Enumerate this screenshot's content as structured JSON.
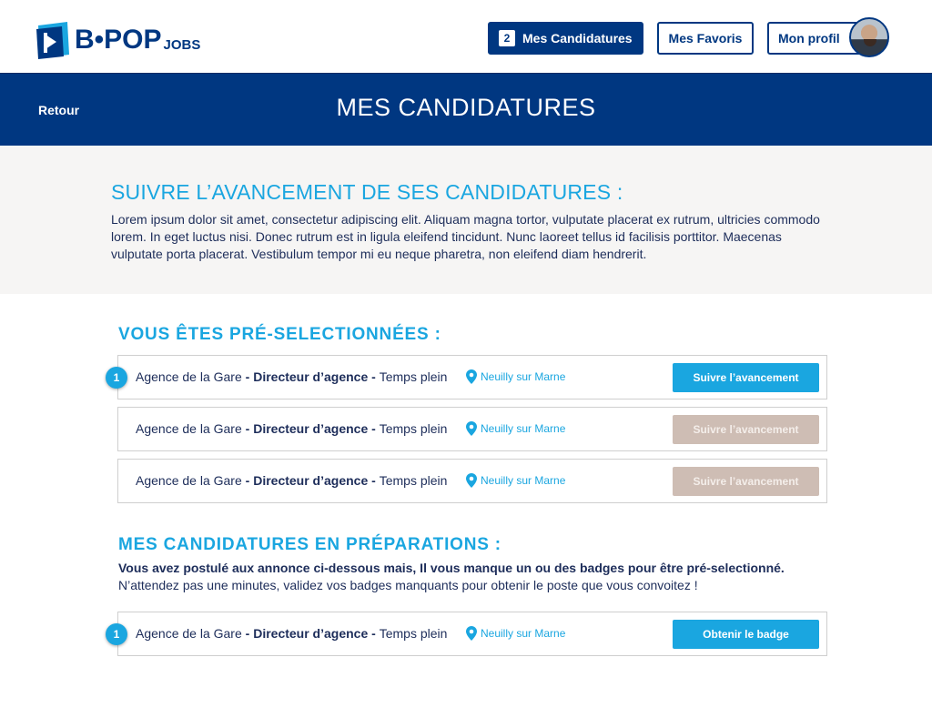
{
  "header": {
    "logo": {
      "brand": "B•POP",
      "sub": "JOBS"
    },
    "nav": {
      "candidatures": {
        "count": "2",
        "label": "Mes Candidatures"
      },
      "favoris": {
        "label": "Mes Favoris"
      },
      "profil": {
        "label": "Mon profil"
      }
    }
  },
  "titlebar": {
    "back": "Retour",
    "title": "MES CANDIDATURES"
  },
  "intro": {
    "title": "SUIVRE L’AVANCEMENT DE SES CANDIDATURES :",
    "text": "Lorem ipsum dolor sit amet, consectetur adipiscing elit. Aliquam magna tortor, vulputate placerat ex rutrum, ultricies commodo lorem. In eget luctus nisi. Donec rutrum est in ligula eleifend tincidunt. Nunc laoreet tellus id facilisis porttitor. Maecenas vulputate porta placerat. Vestibulum tempor mi eu neque pharetra, non eleifend diam hendrerit."
  },
  "preselected": {
    "title": "VOUS ÊTES PRÉ-SELECTIONNÉES :",
    "rows": [
      {
        "badge": "1",
        "agency": "Agence de la Gare",
        "sep1": " - ",
        "role": "Directeur d’agence",
        "sep2": " - ",
        "contract": "Temps plein",
        "location": "Neuilly sur Marne",
        "button": "Suivre l’avancement",
        "state": "active"
      },
      {
        "badge": "",
        "agency": "Agence de la Gare",
        "sep1": " - ",
        "role": "Directeur d’agence",
        "sep2": " - ",
        "contract": "Temps plein",
        "location": "Neuilly sur Marne",
        "button": "Suivre l’avancement",
        "state": "disabled"
      },
      {
        "badge": "",
        "agency": "Agence de la Gare",
        "sep1": " - ",
        "role": "Directeur d’agence",
        "sep2": " - ",
        "contract": "Temps plein",
        "location": "Neuilly sur Marne",
        "button": "Suivre l’avancement",
        "state": "disabled"
      }
    ]
  },
  "preparation": {
    "title": "MES CANDIDATURES EN PRÉPARATIONS :",
    "bold_text": "Vous avez postulé aux annonce ci-dessous mais, Il vous manque un ou des badges pour être pré-selectionné.",
    "text": "N’attendez pas une minutes, validez vos badges manquants pour obtenir le poste que vous convoitez !",
    "rows": [
      {
        "badge": "1",
        "agency": "Agence de la Gare",
        "sep1": " - ",
        "role": "Directeur d’agence",
        "sep2": " - ",
        "contract": "Temps plein",
        "location": "Neuilly sur Marne",
        "button": "Obtenir le badge",
        "state": "active"
      }
    ]
  },
  "colors": {
    "primary": "#003781",
    "accent": "#1aa6e0",
    "disabled": "#cebdb4",
    "intro_bg": "#f6f5f4"
  }
}
